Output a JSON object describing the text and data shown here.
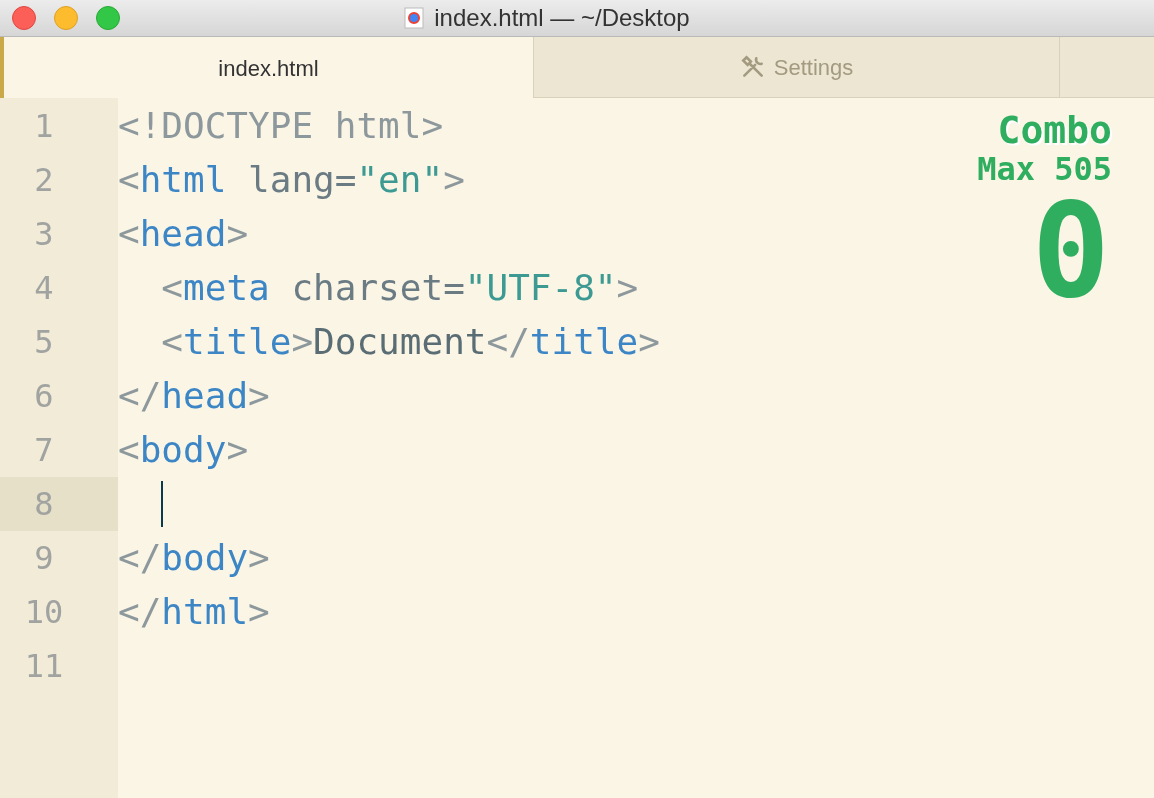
{
  "window": {
    "title": "index.html — ~/Desktop"
  },
  "tabs": [
    {
      "label": "index.html",
      "selected": true,
      "kind": "file"
    },
    {
      "label": "Settings",
      "selected": false,
      "kind": "settings"
    }
  ],
  "editor": {
    "lines": [
      {
        "number": "1",
        "current": false,
        "tokens": [
          {
            "kind": "punct",
            "text": "<!DOCTYPE html>"
          }
        ]
      },
      {
        "number": "2",
        "current": false,
        "tokens": [
          {
            "kind": "punct",
            "text": "<"
          },
          {
            "kind": "tag",
            "text": "html"
          },
          {
            "kind": "attr",
            "text": " lang="
          },
          {
            "kind": "string",
            "text": "\"en\""
          },
          {
            "kind": "punct",
            "text": ">"
          }
        ]
      },
      {
        "number": "3",
        "current": false,
        "tokens": [
          {
            "kind": "punct",
            "text": "<"
          },
          {
            "kind": "tag",
            "text": "head"
          },
          {
            "kind": "punct",
            "text": ">"
          }
        ]
      },
      {
        "number": "4",
        "current": false,
        "tokens": [
          {
            "kind": "punct",
            "text": "  <"
          },
          {
            "kind": "tag",
            "text": "meta"
          },
          {
            "kind": "attr",
            "text": " charset="
          },
          {
            "kind": "string",
            "text": "\"UTF-8\""
          },
          {
            "kind": "punct",
            "text": ">"
          }
        ]
      },
      {
        "number": "5",
        "current": false,
        "tokens": [
          {
            "kind": "punct",
            "text": "  <"
          },
          {
            "kind": "tag",
            "text": "title"
          },
          {
            "kind": "punct",
            "text": ">"
          },
          {
            "kind": "text",
            "text": "Document"
          },
          {
            "kind": "punct",
            "text": "</"
          },
          {
            "kind": "tag",
            "text": "title"
          },
          {
            "kind": "punct",
            "text": ">"
          }
        ]
      },
      {
        "number": "6",
        "current": false,
        "tokens": [
          {
            "kind": "punct",
            "text": "</"
          },
          {
            "kind": "tag",
            "text": "head"
          },
          {
            "kind": "punct",
            "text": ">"
          }
        ]
      },
      {
        "number": "7",
        "current": false,
        "tokens": [
          {
            "kind": "punct",
            "text": "<"
          },
          {
            "kind": "tag",
            "text": "body"
          },
          {
            "kind": "punct",
            "text": ">"
          }
        ]
      },
      {
        "number": "8",
        "current": true,
        "cursor": true
      },
      {
        "number": "9",
        "current": false,
        "tokens": [
          {
            "kind": "punct",
            "text": "</"
          },
          {
            "kind": "tag",
            "text": "body"
          },
          {
            "kind": "punct",
            "text": ">"
          }
        ]
      },
      {
        "number": "10",
        "current": false,
        "tokens": [
          {
            "kind": "punct",
            "text": "</"
          },
          {
            "kind": "tag",
            "text": "html"
          },
          {
            "kind": "punct",
            "text": ">"
          }
        ]
      },
      {
        "number": "11",
        "current": false
      }
    ]
  },
  "combo": {
    "title": "Combo",
    "max": "Max 505",
    "count": "0"
  }
}
